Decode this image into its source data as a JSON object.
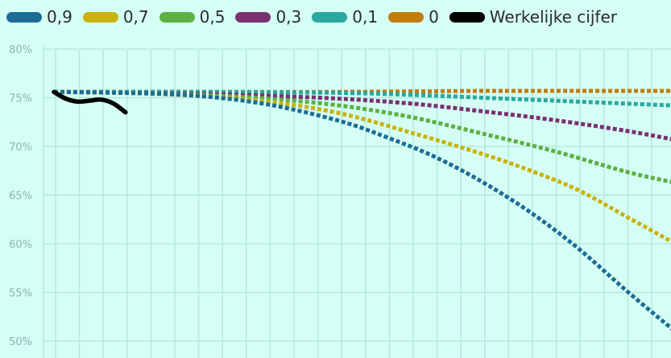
{
  "chart_data": {
    "type": "line",
    "title": "",
    "xlabel": "",
    "ylabel": "",
    "ylim": [
      50,
      80
    ],
    "yticks": [
      "80%",
      "75%",
      "70%",
      "65%",
      "60%",
      "55%",
      "50%"
    ],
    "grid": true,
    "legend_position": "top",
    "x_labels_visible": false,
    "series": [
      {
        "name": "0,9",
        "color": "#1d6c96",
        "dashed": true,
        "x": [
          0,
          3,
          6,
          9,
          12,
          14,
          16,
          18,
          20,
          22,
          24,
          26
        ],
        "y": [
          75.6,
          75.5,
          75.2,
          74.3,
          72.6,
          70.9,
          68.9,
          66.3,
          63.2,
          59.5,
          55.2,
          51.1
        ]
      },
      {
        "name": "0,7",
        "color": "#c9b20b",
        "dashed": true,
        "x": [
          0,
          3,
          6,
          9,
          12,
          15,
          18,
          20,
          22,
          24,
          26
        ],
        "y": [
          75.6,
          75.5,
          75.2,
          74.6,
          73.4,
          71.4,
          69.2,
          67.5,
          65.5,
          62.8,
          60.1
        ]
      },
      {
        "name": "0,5",
        "color": "#5db043",
        "dashed": true,
        "x": [
          0,
          3,
          6,
          9,
          12,
          15,
          18,
          21,
          24,
          26
        ],
        "y": [
          75.6,
          75.5,
          75.3,
          74.9,
          74.2,
          73.0,
          71.3,
          69.5,
          67.4,
          66.3
        ]
      },
      {
        "name": "0,3",
        "color": "#7b3071",
        "dashed": true,
        "x": [
          0,
          3,
          6,
          9,
          12,
          15,
          18,
          21,
          24,
          26
        ],
        "y": [
          75.6,
          75.5,
          75.4,
          75.2,
          74.9,
          74.4,
          73.6,
          72.7,
          71.6,
          70.7
        ]
      },
      {
        "name": "0,1",
        "color": "#2aa7a0",
        "dashed": true,
        "x": [
          0,
          6,
          12,
          15,
          18,
          21,
          24,
          26
        ],
        "y": [
          75.6,
          75.6,
          75.5,
          75.3,
          75.0,
          74.7,
          74.4,
          74.2
        ]
      },
      {
        "name": "0",
        "color": "#c07c0c",
        "dashed": true,
        "x": [
          0,
          6,
          12,
          18,
          24,
          26
        ],
        "y": [
          75.6,
          75.6,
          75.6,
          75.7,
          75.7,
          75.7
        ]
      },
      {
        "name": "Werkelijke cijfer",
        "color": "#000000",
        "dashed": false,
        "x": [
          0,
          0.5,
          1,
          1.5,
          2,
          2.5,
          3
        ],
        "y": [
          75.6,
          74.9,
          74.6,
          74.7,
          74.8,
          74.4,
          73.5
        ]
      }
    ]
  }
}
